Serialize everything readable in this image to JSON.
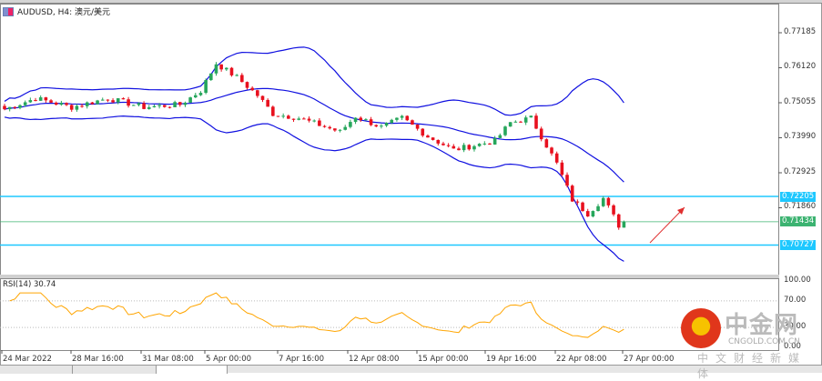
{
  "window": {
    "title": "AUDUSD, H4:  澳元/美元",
    "icon": "chart-window-icon"
  },
  "price_axis": [
    "0.77185",
    "0.76120",
    "0.75055",
    "0.73990",
    "0.72925",
    "0.71860"
  ],
  "price_ticks": [
    0.77185,
    0.7612,
    0.75055,
    0.7399,
    0.72925,
    0.7186
  ],
  "levels": {
    "resistance": "0.72205",
    "current": "0.71434",
    "support": "0.70727",
    "resistance_val": 0.72205,
    "current_val": 0.71434,
    "support_val": 0.70727,
    "line_color": "#1ec8ff",
    "current_color": "#3cb371"
  },
  "colors": {
    "bull": "#26a65b",
    "bear": "#e8101e",
    "band": "#1010e0",
    "rsi": "#ffa500",
    "arrow": "#e03030"
  },
  "rsi": {
    "label": "RSI(14) 30.74",
    "levels": [
      "100.00",
      "70.00",
      "30.00",
      "0.00"
    ]
  },
  "time_axis": [
    "24 Mar 2022",
    "28 Mar 16:00",
    "31 Mar 08:00",
    "5 Apr 00:00",
    "7 Apr 16:00",
    "12 Apr 08:00",
    "15 Apr 00:00",
    "19 Apr 16:00",
    "22 Apr 08:00",
    "27 Apr 00:00"
  ],
  "chart_data": {
    "type": "candlestick",
    "symbol": "AUDUSD",
    "timeframe": "H4",
    "ylim": [
      0.7,
      0.779
    ],
    "close_keypoints": [
      [
        0,
        0.7486
      ],
      [
        6,
        0.7519
      ],
      [
        13,
        0.7492
      ],
      [
        20,
        0.7519
      ],
      [
        27,
        0.7492
      ],
      [
        34,
        0.75
      ],
      [
        38,
        0.7542
      ],
      [
        41,
        0.7625
      ],
      [
        45,
        0.7583
      ],
      [
        49,
        0.7528
      ],
      [
        52,
        0.7472
      ],
      [
        57,
        0.7459
      ],
      [
        65,
        0.7417
      ],
      [
        68,
        0.7464
      ],
      [
        73,
        0.7431
      ],
      [
        77,
        0.7459
      ],
      [
        82,
        0.7403
      ],
      [
        87,
        0.7362
      ],
      [
        91,
        0.7376
      ],
      [
        95,
        0.7389
      ],
      [
        98,
        0.7445
      ],
      [
        102,
        0.7459
      ],
      [
        104,
        0.7403
      ],
      [
        107,
        0.732
      ],
      [
        110,
        0.721
      ],
      [
        113,
        0.7168
      ],
      [
        116,
        0.7215
      ],
      [
        119,
        0.7132
      ],
      [
        120,
        0.7143
      ]
    ],
    "candles": 121
  },
  "watermark": {
    "name": "中金网",
    "url": "CNGOLD.COM.CN",
    "tagline": "中文财经新媒体"
  }
}
